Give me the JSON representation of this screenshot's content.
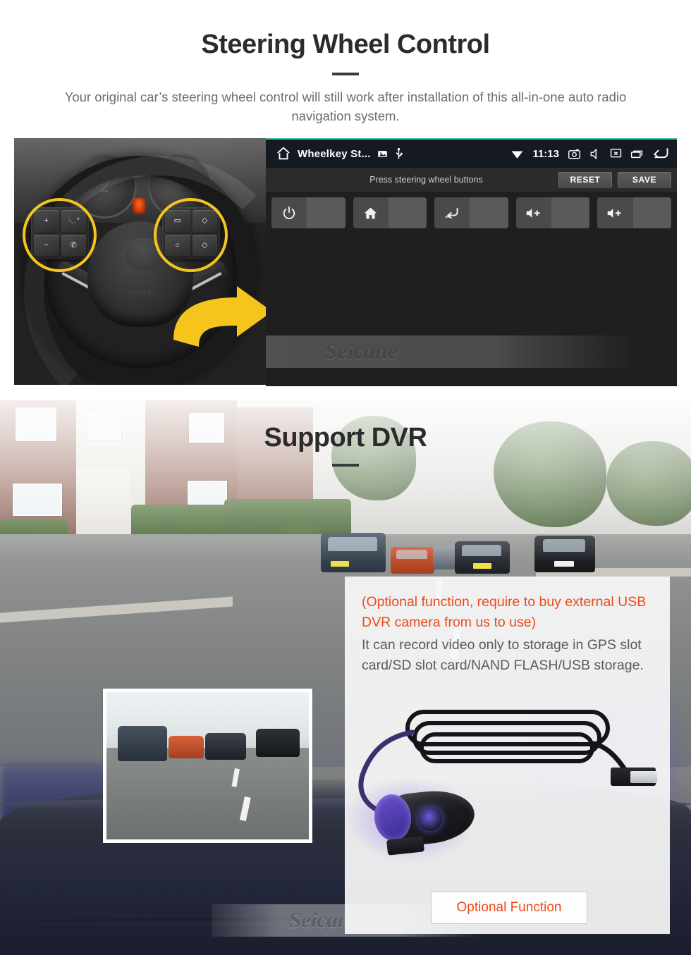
{
  "section1": {
    "title": "Steering Wheel Control",
    "subtitle": "Your original car’s steering wheel control will still work after installation of this all-in-one auto radio navigation system.",
    "steering_wheel_photo": {
      "alt": "Car steering wheel with highlighted control button clusters",
      "gauge_number": "2",
      "airbag_label": "AIRBAG",
      "left_cluster_keys": [
        "+",
        "−",
        "📞⁺",
        "✆"
      ],
      "right_cluster_keys": [
        "▭",
        "◇",
        "○",
        "◇"
      ]
    },
    "head_unit": {
      "status_bar": {
        "home_icon": "home-icon",
        "app_title": "Wheelkey St...",
        "image_icon": "image-icon",
        "usb_icon": "usb-icon",
        "wifi_icon": "wifi-icon",
        "clock": "11:13",
        "screenshot_icon": "screenshot-camera-icon",
        "volume_icon": "volume-icon",
        "screen-off_icon": "screen-off-icon",
        "recents_icon": "recent-apps-icon",
        "back_icon": "back-arrow-icon"
      },
      "action_bar": {
        "hint": "Press steering wheel buttons",
        "reset_label": "RESET",
        "save_label": "SAVE"
      },
      "key_slots": [
        {
          "icon": "power-icon",
          "label": ""
        },
        {
          "icon": "home-icon",
          "label": ""
        },
        {
          "icon": "back-icon",
          "label": ""
        },
        {
          "icon": "volume-up-icon",
          "label": ""
        },
        {
          "icon": "volume-up-icon",
          "label": ""
        }
      ],
      "watermark": "Seicane",
      "accent_color": "#46c0a0"
    }
  },
  "section2": {
    "title": "Support DVR",
    "background_alt": "Dashcam view of a residential street with parked cars, seen over a car dashboard",
    "preview_alt": "Dashcam video still showing road with parked cars and lane marking",
    "info_card": {
      "highlight_text": "(Optional function, require to buy external USB DVR camera from us to use)",
      "body_text": "It can record video only to storage in GPS slot card/SD slot card/NAND FLASH/USB storage.",
      "product_alt": "Black USB DVR camera with coiled cable and USB plug",
      "button_label": "Optional Function",
      "highlight_color": "#ee4a19"
    },
    "watermark": "Seicane"
  }
}
